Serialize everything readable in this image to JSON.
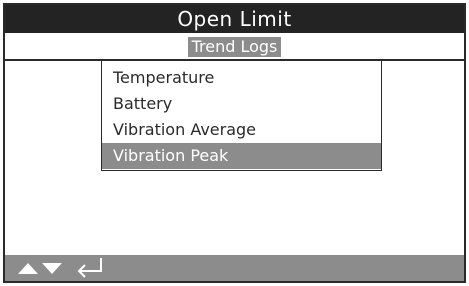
{
  "header": {
    "title": "Open Limit"
  },
  "subheader": {
    "title": "Trend Logs"
  },
  "menu": {
    "items": [
      {
        "label": "Temperature",
        "selected": false
      },
      {
        "label": "Battery",
        "selected": false
      },
      {
        "label": "Vibration Average",
        "selected": false
      },
      {
        "label": "Vibration Peak",
        "selected": true
      }
    ]
  },
  "footer": {
    "icons": [
      "up-arrow-icon",
      "down-arrow-icon",
      "enter-icon"
    ]
  },
  "colors": {
    "title_bar": "#232323",
    "highlight": "#8c8c8c",
    "text": "#2a2a2a",
    "background": "#ffffff"
  }
}
